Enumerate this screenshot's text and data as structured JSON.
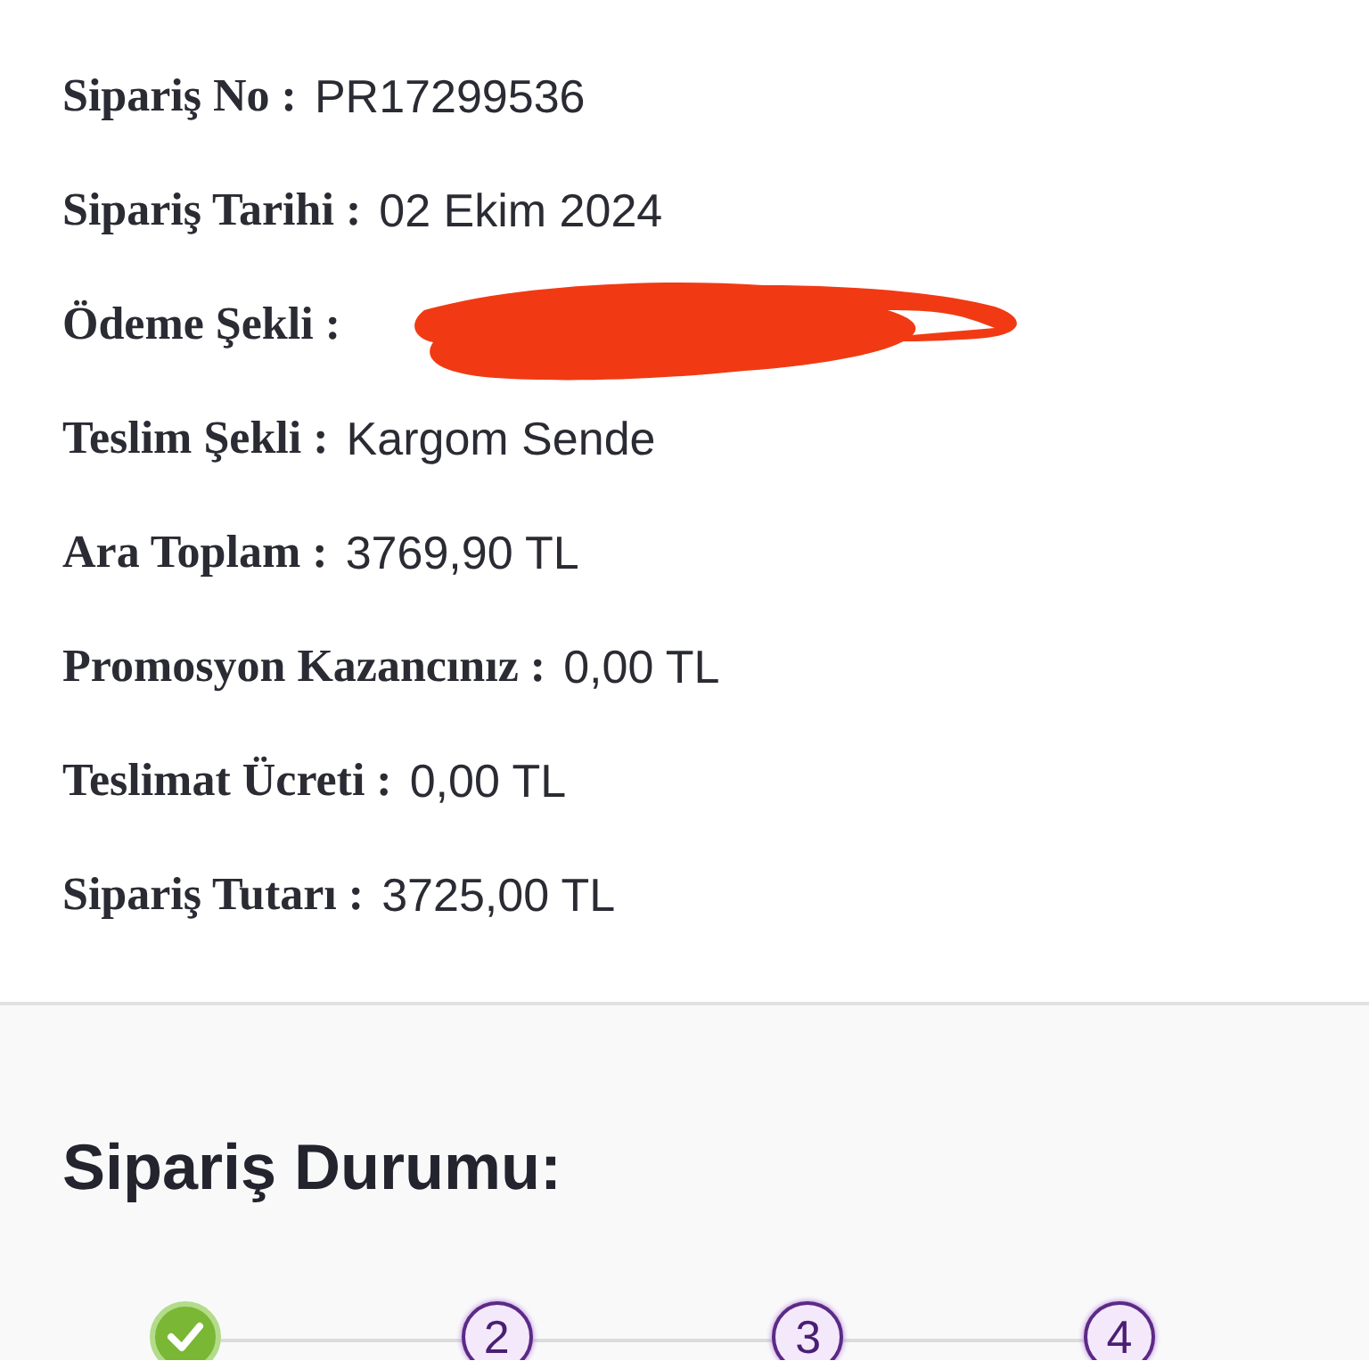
{
  "order_details": [
    {
      "label": "Sipariş No :",
      "value": "PR17299536",
      "redacted": false
    },
    {
      "label": "Sipariş Tarihi :",
      "value": "02 Ekim 2024",
      "redacted": false
    },
    {
      "label": "Ödeme Şekli :",
      "redacted": true
    },
    {
      "label": "Teslim Şekli :",
      "value": "Kargom Sende",
      "redacted": false
    },
    {
      "label": "Ara Toplam :",
      "value": "3769,90 TL",
      "redacted": false
    },
    {
      "label": "Promosyon Kazancınız :",
      "value": "0,00 TL",
      "redacted": false
    },
    {
      "label": "Teslimat Ücreti :",
      "value": "0,00 TL",
      "redacted": false
    },
    {
      "label": "Sipariş Tutarı :",
      "value": "3725,00 TL",
      "redacted": false
    }
  ],
  "order_status": {
    "title": "Sipariş Durumu:",
    "steps": [
      {
        "done": true
      },
      {
        "done": false,
        "label": "2"
      },
      {
        "done": false,
        "label": "3"
      },
      {
        "done": false,
        "label": "4"
      }
    ]
  }
}
